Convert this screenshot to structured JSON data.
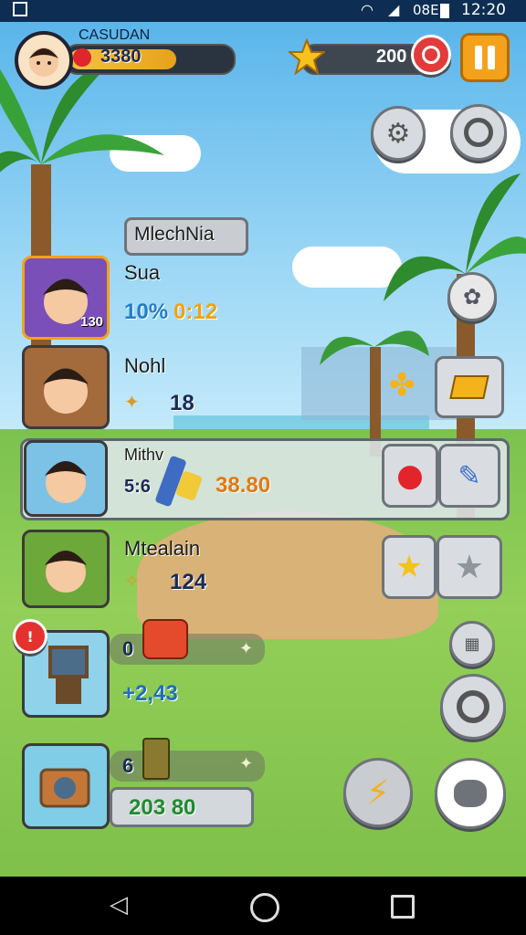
{
  "status_bar": {
    "carrier": "08E",
    "time": "12:20"
  },
  "hud": {
    "player_name": "CASUDAN",
    "coins": "3380",
    "coin_bar_fill": 0.68,
    "stars": "200",
    "pause_icon": "pause-icon"
  },
  "banner": {
    "title": "MlechNia"
  },
  "roster": [
    {
      "name": "Sua",
      "stat_left": "10%",
      "stat_right": "0:12",
      "badge": "130"
    },
    {
      "name": "Nohl",
      "stat_left": "",
      "stat_right": "18",
      "badge": ""
    },
    {
      "name": "Mithv",
      "stat_left": "5:6",
      "stat_right": "38.80",
      "badge": ""
    },
    {
      "name": "Mtealain",
      "stat_left": "",
      "stat_right": "124",
      "badge": ""
    }
  ],
  "crafting": [
    {
      "count": "0",
      "value": "+2,43"
    },
    {
      "count": "6",
      "value": "203 80"
    }
  ],
  "colors": {
    "accent": "#f4a21b",
    "hud_bg": "#0d2e52",
    "card_bg": "#e1e8ee"
  }
}
